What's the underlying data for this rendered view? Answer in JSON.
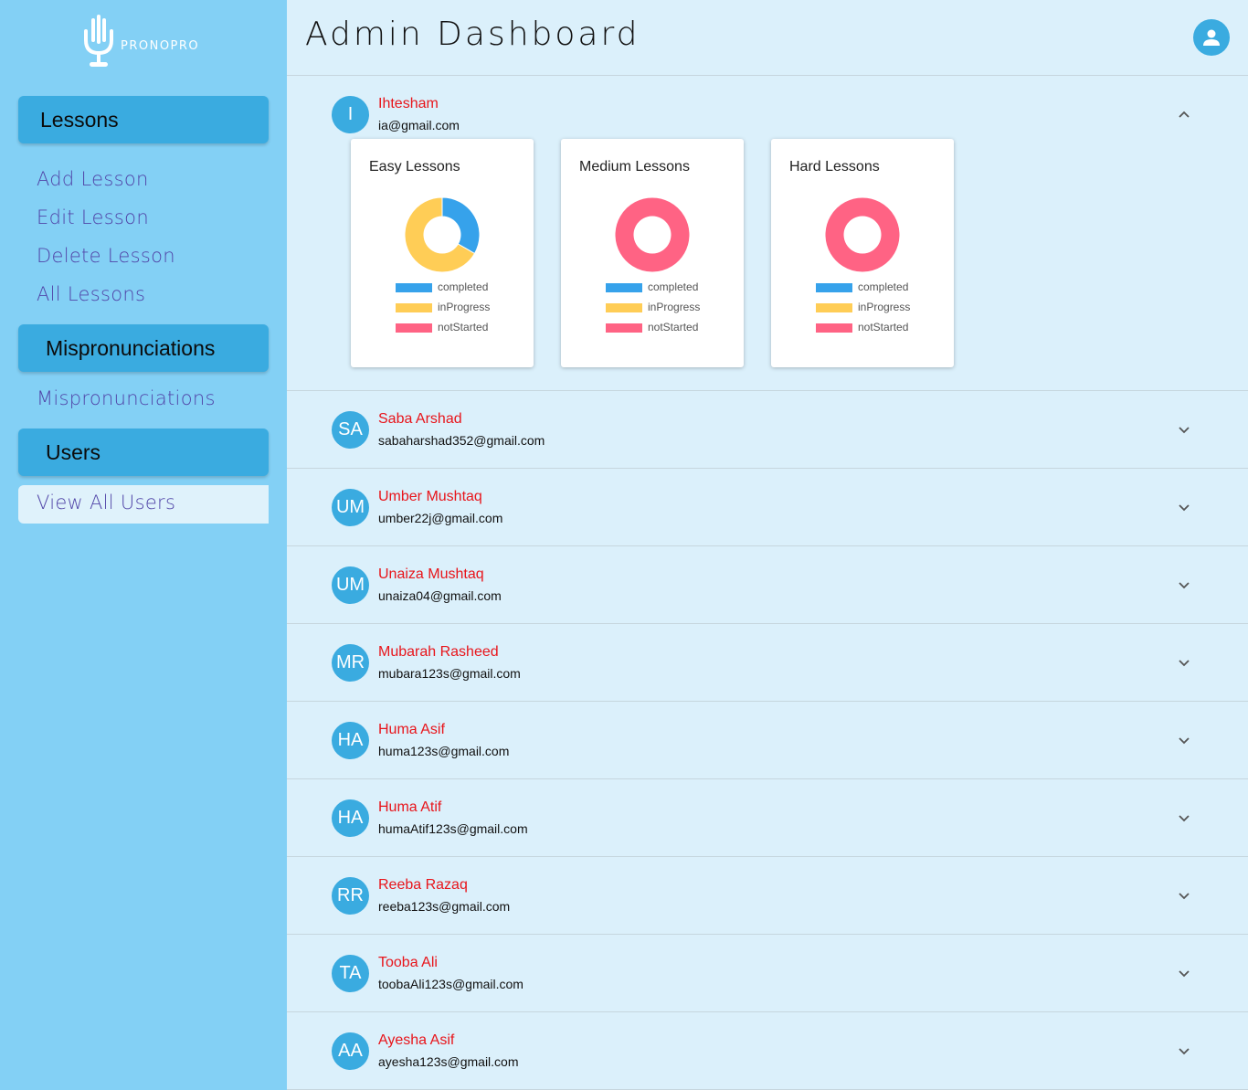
{
  "app": {
    "logo_text": "PRONOPRO"
  },
  "header": {
    "title": "Admin Dashboard"
  },
  "sidebar": {
    "lessons_label": "Lessons",
    "lesson_links": [
      "Add Lesson",
      "Edit Lesson",
      "Delete Lesson",
      "All Lessons"
    ],
    "mispronunciations_label": "Mispronunciations",
    "mispronunciation_links": [
      "Mispronunciations"
    ],
    "users_label": "Users",
    "user_links": [
      "View All Users"
    ]
  },
  "colors": {
    "completed": "#36a2eb",
    "inProgress": "#ffcd56",
    "notStarted": "#ff6384",
    "name_color": "#e8151b",
    "accent": "#3aabe0"
  },
  "users": [
    {
      "initials": "I",
      "name": "Ihtesham",
      "email": "ia@gmail.com",
      "expanded": true
    },
    {
      "initials": "SA",
      "name": "Saba Arshad",
      "email": "sabaharshad352@gmail.com",
      "expanded": false
    },
    {
      "initials": "UM",
      "name": "Umber Mushtaq",
      "email": "umber22j@gmail.com",
      "expanded": false
    },
    {
      "initials": "UM",
      "name": "Unaiza Mushtaq",
      "email": "unaiza04@gmail.com",
      "expanded": false
    },
    {
      "initials": "MR",
      "name": "Mubarah Rasheed",
      "email": "mubara123s@gmail.com",
      "expanded": false
    },
    {
      "initials": "HA",
      "name": "Huma Asif",
      "email": "huma123s@gmail.com",
      "expanded": false
    },
    {
      "initials": "HA",
      "name": "Huma Atif",
      "email": "humaAtif123s@gmail.com",
      "expanded": false
    },
    {
      "initials": "RR",
      "name": "Reeba Razaq",
      "email": "reeba123s@gmail.com",
      "expanded": false
    },
    {
      "initials": "TA",
      "name": "Tooba Ali",
      "email": "toobaAli123s@gmail.com",
      "expanded": false
    },
    {
      "initials": "AA",
      "name": "Ayesha Asif",
      "email": "ayesha123s@gmail.com",
      "expanded": false
    }
  ],
  "chart_data": [
    {
      "type": "pie",
      "variant": "doughnut",
      "title": "Easy Lessons",
      "categories": [
        "completed",
        "inProgress",
        "notStarted"
      ],
      "values": [
        1,
        2,
        0
      ],
      "legend": "bottom"
    },
    {
      "type": "pie",
      "variant": "doughnut",
      "title": "Medium Lessons",
      "categories": [
        "completed",
        "inProgress",
        "notStarted"
      ],
      "values": [
        0,
        0,
        1
      ],
      "legend": "bottom"
    },
    {
      "type": "pie",
      "variant": "doughnut",
      "title": "Hard Lessons",
      "categories": [
        "completed",
        "inProgress",
        "notStarted"
      ],
      "values": [
        0,
        0,
        1
      ],
      "legend": "bottom"
    }
  ]
}
